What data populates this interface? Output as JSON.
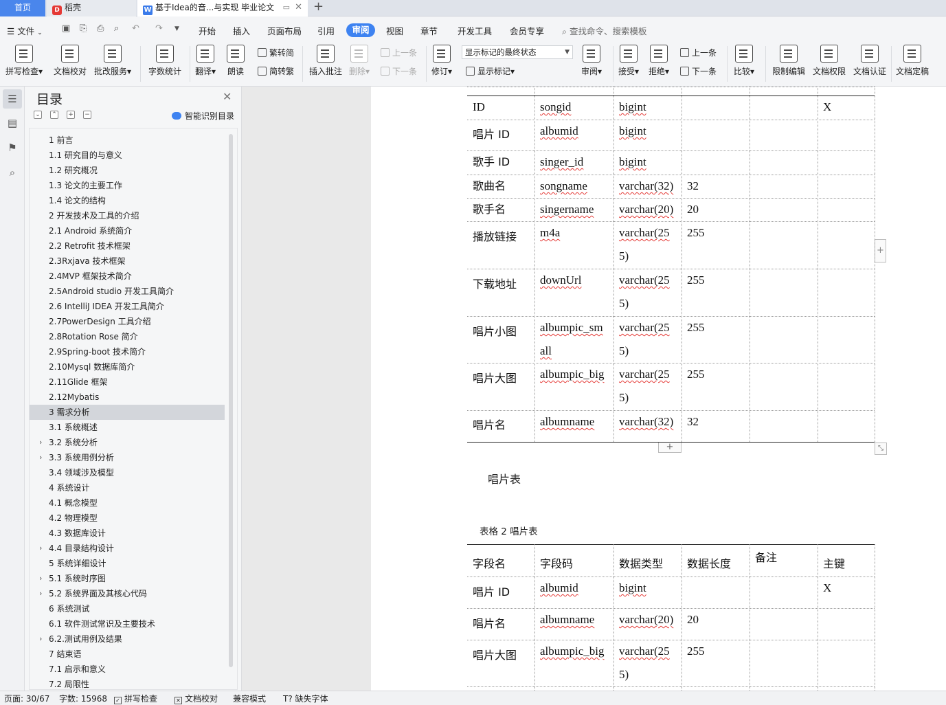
{
  "tabs": {
    "home": "首页",
    "daoke": "稻壳",
    "doc": "基于Idea的音...与实现 毕业论文"
  },
  "menu": {
    "file": "文件",
    "items": [
      "开始",
      "插入",
      "页面布局",
      "引用",
      "审阅",
      "视图",
      "章节",
      "开发工具",
      "会员专享"
    ],
    "active": "审阅",
    "search": "查找命令、搜索模板"
  },
  "toolbar": {
    "spell": "拼写检查",
    "proofread": "文档校对",
    "batch": "批改服务",
    "wordcount": "字数统计",
    "translate": "翻译",
    "read": "朗读",
    "t2s": "繁转简",
    "s2t": "简转繁",
    "insert_comment": "插入批注",
    "delete": "删除",
    "prev_comment": "上一条",
    "next_comment": "下一条",
    "track": "修订",
    "markup_state": "显示标记的最终状态",
    "show_markup": "显示标记",
    "review": "审阅",
    "accept": "接受",
    "reject": "拒绝",
    "prev_change": "上一条",
    "next_change": "下一条",
    "compare": "比较",
    "restrict": "限制编辑",
    "permission": "文档权限",
    "certify": "文档认证",
    "finalize": "文档定稿"
  },
  "toc": {
    "title": "目录",
    "ai_label": "智能识别目录",
    "items": [
      {
        "label": "1  前言",
        "arrow": false
      },
      {
        "label": "1.1 研究目的与意义",
        "arrow": false
      },
      {
        "label": "1.2 研究概况",
        "arrow": false
      },
      {
        "label": "1.3  论文的主要工作",
        "arrow": false
      },
      {
        "label": "1.4  论文的结构",
        "arrow": false
      },
      {
        "label": "2 开发技术及工具的介绍",
        "arrow": false
      },
      {
        "label": "2.1 Android 系统简介",
        "arrow": false
      },
      {
        "label": "2.2 Retrofit 技术框架",
        "arrow": false
      },
      {
        "label": "2.3Rxjava 技术框架",
        "arrow": false
      },
      {
        "label": "2.4MVP 框架技术简介",
        "arrow": false
      },
      {
        "label": "2.5Android studio 开发工具简介",
        "arrow": false
      },
      {
        "label": "2.6 IntelliJ IDEA 开发工具简介",
        "arrow": false
      },
      {
        "label": "2.7PowerDesign 工具介绍",
        "arrow": false
      },
      {
        "label": "2.8Rotation Rose 简介",
        "arrow": false
      },
      {
        "label": "2.9Spring-boot 技术简介",
        "arrow": false
      },
      {
        "label": "2.10Mysql 数据库简介",
        "arrow": false
      },
      {
        "label": "2.11Glide 框架",
        "arrow": false
      },
      {
        "label": "2.12Mybatis",
        "arrow": false
      },
      {
        "label": "3 需求分析",
        "arrow": false,
        "active": true
      },
      {
        "label": "3.1 系统概述",
        "arrow": false
      },
      {
        "label": "3.2 系统分析",
        "arrow": true
      },
      {
        "label": "3.3 系统用例分析",
        "arrow": true
      },
      {
        "label": "3.4 领域涉及模型",
        "arrow": false
      },
      {
        "label": "4 系统设计",
        "arrow": false
      },
      {
        "label": "4.1 概念模型",
        "arrow": false
      },
      {
        "label": "4.2 物理模型",
        "arrow": false
      },
      {
        "label": "4.3  数据库设计",
        "arrow": false
      },
      {
        "label": "4.4  目录结构设计",
        "arrow": true
      },
      {
        "label": "5  系统详细设计",
        "arrow": false
      },
      {
        "label": "5.1 系统时序图",
        "arrow": true
      },
      {
        "label": "5.2 系统界面及其核心代码",
        "arrow": true
      },
      {
        "label": "6 系统测试",
        "arrow": false
      },
      {
        "label": "6.1  软件测试常识及主要技术",
        "arrow": false
      },
      {
        "label": "6.2.测试用例及结果",
        "arrow": true
      },
      {
        "label": "7 结束语",
        "arrow": false
      },
      {
        "label": "7.1 启示和意义",
        "arrow": false
      },
      {
        "label": "7.2 局限性",
        "arrow": false
      }
    ]
  },
  "table1": {
    "rows": [
      [
        "ID",
        "songid",
        "bigint",
        "",
        "",
        "X"
      ],
      [
        "唱片 ID",
        "albumid",
        "bigint",
        "",
        "",
        ""
      ],
      [
        "歌手 ID",
        "singer_id",
        "bigint",
        "",
        "",
        ""
      ],
      [
        "歌曲名",
        "songname",
        "varchar(32)",
        "32",
        "",
        ""
      ],
      [
        "歌手名",
        "singername",
        "varchar(20)",
        "20",
        "",
        ""
      ],
      [
        "播放链接",
        "m4a",
        "varchar(25|5)",
        "255",
        "",
        ""
      ],
      [
        "下载地址",
        "downUrl",
        "varchar(25|5)",
        "255",
        "",
        ""
      ],
      [
        "唱片小图",
        "albumpic_sm|all",
        "varchar(25|5)",
        "255",
        "",
        ""
      ],
      [
        "唱片大图",
        "albumpic_big",
        "varchar(25|5)",
        "255",
        "",
        ""
      ],
      [
        "唱片名",
        "albumname",
        "varchar(32)",
        "32",
        "",
        ""
      ]
    ]
  },
  "caption": "唱片表",
  "table2_title": "表格  2 唱片表",
  "table2": {
    "headers": [
      "字段名",
      "字段码",
      "数据类型",
      "数据长度",
      "备注",
      "主键"
    ],
    "rows": [
      [
        "唱片 ID",
        "albumid",
        "bigint",
        "",
        "",
        "X"
      ],
      [
        "唱片名",
        "albumname",
        "varchar(20)",
        "20",
        "",
        ""
      ],
      [
        "唱片大图",
        "albumpic_big",
        "varchar(25|5)",
        "255",
        "",
        ""
      ]
    ]
  },
  "status": {
    "page": "页面: 30/67",
    "words": "字数: 15968",
    "spell": "拼写检查",
    "proof": "文档校对",
    "compat": "兼容模式",
    "missing_font": "缺失字体"
  }
}
